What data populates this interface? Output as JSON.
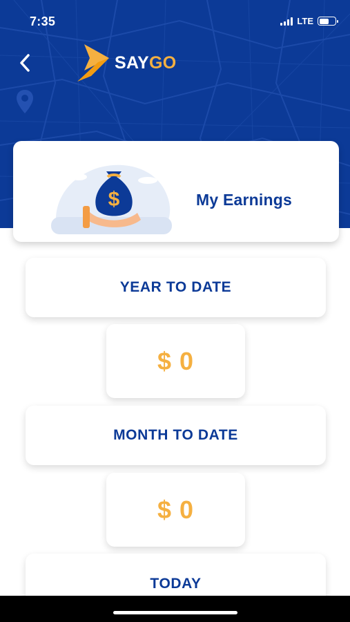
{
  "status_bar": {
    "time": "7:35",
    "network": "LTE"
  },
  "header": {
    "brand_primary": "SAY",
    "brand_accent": "GO",
    "colors": {
      "primary": "#0c3a97",
      "accent": "#f5b041"
    }
  },
  "earnings_card": {
    "title": "My Earnings"
  },
  "sections": [
    {
      "label": "YEAR TO DATE",
      "value": "$ 0"
    },
    {
      "label": "MONTH TO DATE",
      "value": "$ 0"
    },
    {
      "label": "TODAY"
    }
  ],
  "icons": {
    "back": "chevron-left-icon",
    "logo": "saygo-logo-icon",
    "pin": "map-pin-icon",
    "money_bag": "money-bag-icon"
  }
}
